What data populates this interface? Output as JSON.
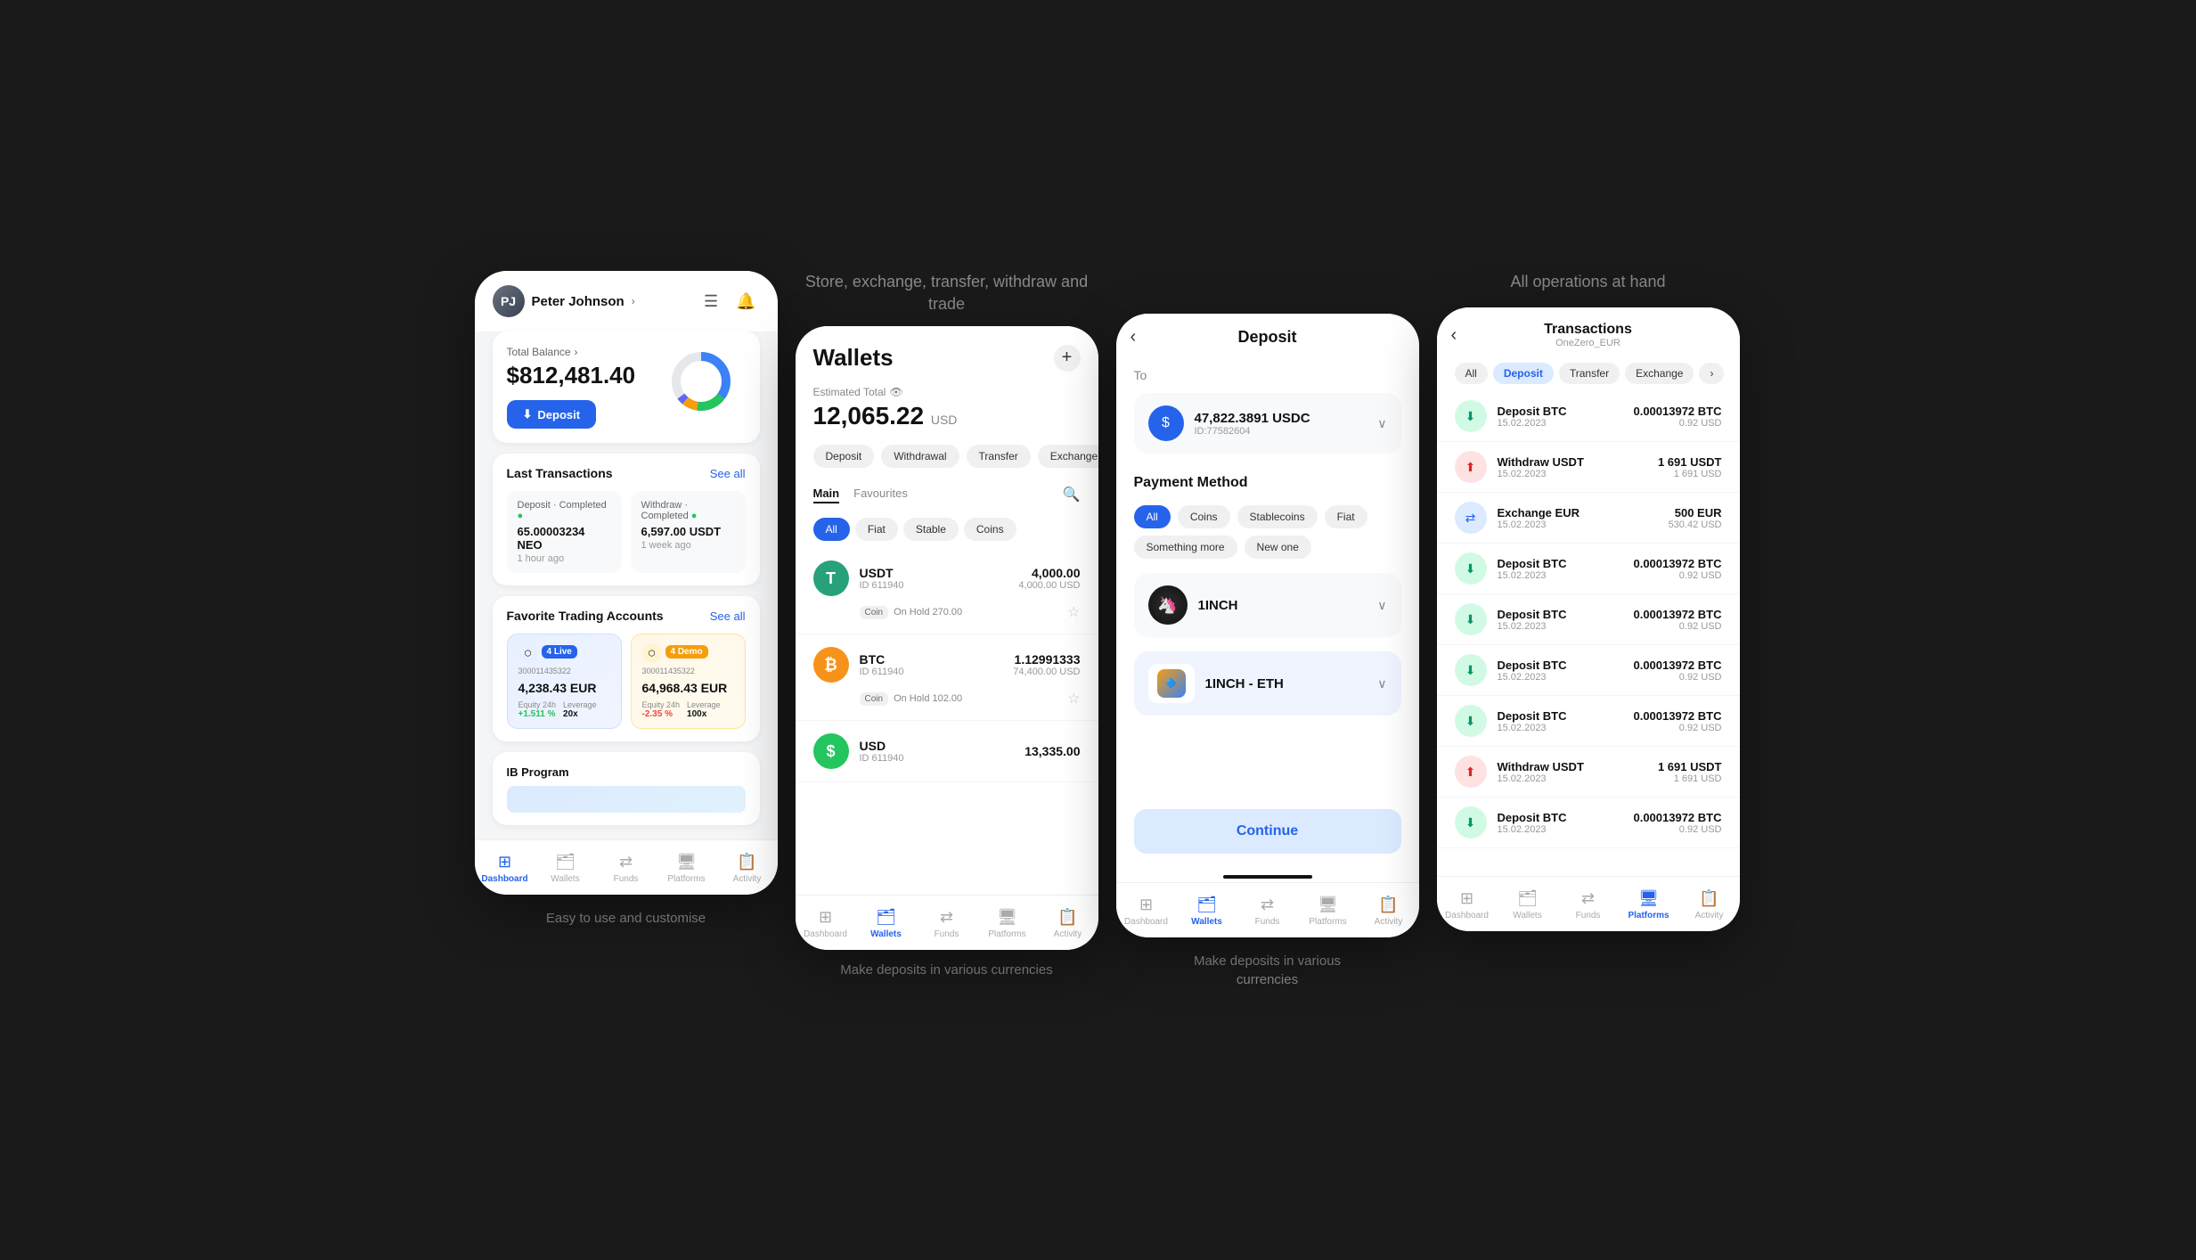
{
  "page": {
    "bg_color": "#1a1a1a"
  },
  "captions": {
    "top_center": "Store, exchange, transfer, withdraw and trade",
    "top_right": "All operations at hand",
    "bottom_left": "Easy to use and customise",
    "bottom_center": "Make deposits in various currencies"
  },
  "phone1": {
    "user": {
      "name": "Peter Johnson",
      "avatar_initials": "PJ"
    },
    "balance": {
      "label": "Total Balance",
      "amount": "$812,481.40"
    },
    "deposit_btn": "Deposit",
    "last_transactions": {
      "title": "Last Transactions",
      "see_all": "See all",
      "items": [
        {
          "type": "Deposit · Completed",
          "amount": "65.00003234 NEO",
          "time": "1 hour ago"
        },
        {
          "type": "Withdraw · Completed",
          "amount": "6,597.00 USDT",
          "time": "1 week ago"
        }
      ]
    },
    "trading": {
      "title": "Favorite Trading Accounts",
      "see_all": "See all",
      "cards": [
        {
          "type": "Live",
          "id": "300011435322",
          "amount": "4,238.43 EUR",
          "equity_label": "Equity 24h",
          "equity_val": "+1.511 %",
          "leverage_label": "Leverage",
          "leverage_val": "20x",
          "badge_num": "4"
        },
        {
          "type": "Demo",
          "id": "300011435322",
          "amount": "64,968.43 EUR",
          "equity_label": "Equity 24h",
          "equity_val": "-2.35 %",
          "leverage_label": "Leverage",
          "leverage_val": "100x",
          "badge_num": "4"
        }
      ]
    },
    "ib_program": "IB Program",
    "nav": [
      "Dashboard",
      "Wallets",
      "Funds",
      "Platforms",
      "Activity"
    ],
    "nav_active": 0
  },
  "phone2": {
    "title": "Wallets",
    "estimated_label": "Estimated Total",
    "total_amount": "12,065.22",
    "total_currency": "USD",
    "filter_tabs": [
      "Deposit",
      "Withdrawal",
      "Transfer",
      "Exchange"
    ],
    "list_tabs": [
      "Main",
      "Favourites"
    ],
    "list_active": 0,
    "coin_tabs": [
      "All",
      "Fiat",
      "Stable",
      "Coins"
    ],
    "coin_active": 0,
    "wallets": [
      {
        "symbol": "T",
        "name": "USDT",
        "id": "ID 611940",
        "amount": "4,000.00",
        "usd": "4,000.00 USD",
        "on_hold": "On Hold 270.00",
        "color": "#26a17b"
      },
      {
        "symbol": "₿",
        "name": "BTC",
        "id": "ID 611940",
        "amount": "1.12991333",
        "usd": "74,400.00 USD",
        "on_hold": "On Hold 102.00",
        "color": "#f7931a"
      },
      {
        "symbol": "$",
        "name": "USD",
        "id": "ID 611940",
        "amount": "13,335.00",
        "usd": "",
        "on_hold": "",
        "color": "#22c55e"
      }
    ],
    "nav": [
      "Dashboard",
      "Wallets",
      "Funds",
      "Platforms",
      "Activity"
    ],
    "nav_active": 1
  },
  "phone3": {
    "title": "Deposit",
    "to_label": "To",
    "account": {
      "amount": "47,822.3891 USDC",
      "id": "ID:77582604"
    },
    "payment_method_label": "Payment Method",
    "payment_tabs": [
      "All",
      "Coins",
      "Stablecoins",
      "Fiat",
      "Something more",
      "New one"
    ],
    "payment_active": 0,
    "options": [
      {
        "name": "1INCH",
        "has_sub": true,
        "sub_name": "1INCH - ETH"
      }
    ],
    "continue_btn": "Continue",
    "nav": [
      "Dashboard",
      "Wallets",
      "Funds",
      "Platforms",
      "Activity"
    ],
    "nav_active": 1
  },
  "phone4": {
    "title": "Transactions",
    "subtitle": "OneZero_EUR",
    "filter_tabs": [
      "All",
      "Deposit",
      "Transfer",
      "Exchange"
    ],
    "filter_active": 1,
    "transactions": [
      {
        "type": "deposit",
        "name": "Deposit BTC",
        "date": "15.02.2023",
        "amount": "0.00013972 BTC",
        "usd": "0.92 USD"
      },
      {
        "type": "withdraw",
        "name": "Withdraw USDT",
        "date": "15.02.2023",
        "amount": "1 691 USDT",
        "usd": "1 691 USD"
      },
      {
        "type": "exchange",
        "name": "Exchange EUR",
        "date": "15.02.2023",
        "amount": "500 EUR",
        "usd": "530.42 USD"
      },
      {
        "type": "deposit",
        "name": "Deposit BTC",
        "date": "15.02.2023",
        "amount": "0.00013972 BTC",
        "usd": "0.92 USD"
      },
      {
        "type": "deposit",
        "name": "Deposit BTC",
        "date": "15.02.2023",
        "amount": "0.00013972 BTC",
        "usd": "0.92 USD"
      },
      {
        "type": "deposit",
        "name": "Deposit BTC",
        "date": "15.02.2023",
        "amount": "0.00013972 BTC",
        "usd": "0.92 USD"
      },
      {
        "type": "deposit",
        "name": "Deposit BTC",
        "date": "15.02.2023",
        "amount": "0.00013972 BTC",
        "usd": "0.92 USD"
      },
      {
        "type": "withdraw",
        "name": "Withdraw USDT",
        "date": "15.02.2023",
        "amount": "1 691 USDT",
        "usd": "1 691 USD"
      },
      {
        "type": "deposit",
        "name": "Deposit BTC",
        "date": "15.02.2023",
        "amount": "0.00013972 BTC",
        "usd": "0.92 USD"
      }
    ],
    "nav": [
      "Dashboard",
      "Wallets",
      "Funds",
      "Platforms",
      "Activity"
    ],
    "nav_active": 3
  }
}
